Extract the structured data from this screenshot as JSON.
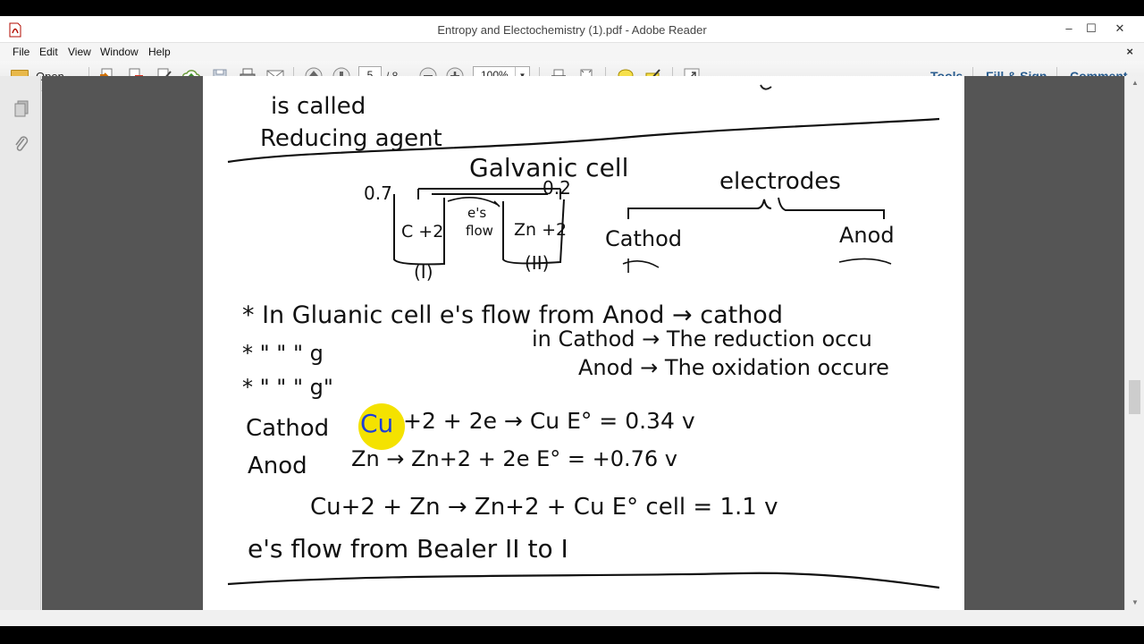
{
  "window": {
    "title": "Entropy and Electochemistry (1).pdf - Adobe Reader",
    "controls": {
      "minimize": "–",
      "maximize": "☐",
      "close": "✕"
    }
  },
  "menu": {
    "items": [
      "File",
      "Edit",
      "View",
      "Window",
      "Help"
    ],
    "close_doc": "×"
  },
  "toolbar": {
    "open_label": "Open",
    "page_current": "5",
    "page_total": "/ 8",
    "zoom": "100%",
    "icons": [
      "create-pdf-icon",
      "convert-icon",
      "edit-icon",
      "cloud-upload-icon",
      "save-icon",
      "print-icon",
      "email-icon",
      "previous-page-icon",
      "next-page-icon",
      "zoom-out-icon",
      "zoom-in-icon",
      "fit-width-icon",
      "fit-page-icon",
      "comment-icon",
      "highlight-icon",
      "expand-icon"
    ],
    "right_links": {
      "tools": "Tools",
      "fill_sign": "Fill & Sign",
      "comment": "Comment"
    }
  },
  "left_pane": {
    "icons": [
      "pages-icon",
      "attachments-icon"
    ]
  },
  "document": {
    "lines": {
      "l1": "is called",
      "l2": "Reducing agent",
      "title": "Galvanic cell",
      "v1": "0.7",
      "v2": "0.2",
      "left_beaker": "C +2",
      "flow_top": "e's",
      "flow_bottom": "flow",
      "right_beaker": "Zn +2",
      "label_i": "(I)",
      "label_ii": "(II)",
      "electrodes": "electrodes",
      "cathod": "Cathod",
      "anod": "Anod",
      "s1": "* In Gluanic cell e's flow from Anod → cathod",
      "s2_marks": "*   \"     \"     \"   g",
      "s2_text": "in Cathod → The reduction occu",
      "s3_marks": "*   \"     \"     \"   g\"",
      "s3_text": "Anod → The oxidation occure",
      "eq1_label": "Cathod",
      "eq1_cu": "Cu",
      "eq1_rest": "+2 + 2e → Cu   E° = 0.34 v",
      "eq2_label": "Anod",
      "eq2_rest": "Zn → Zn+2 + 2e   E° = +0.76   v",
      "eq3": "Cu+2 + Zn → Zn+2 + Cu   E° cell = 1.1 v",
      "final": "e's flow from Bealer II to I"
    }
  }
}
